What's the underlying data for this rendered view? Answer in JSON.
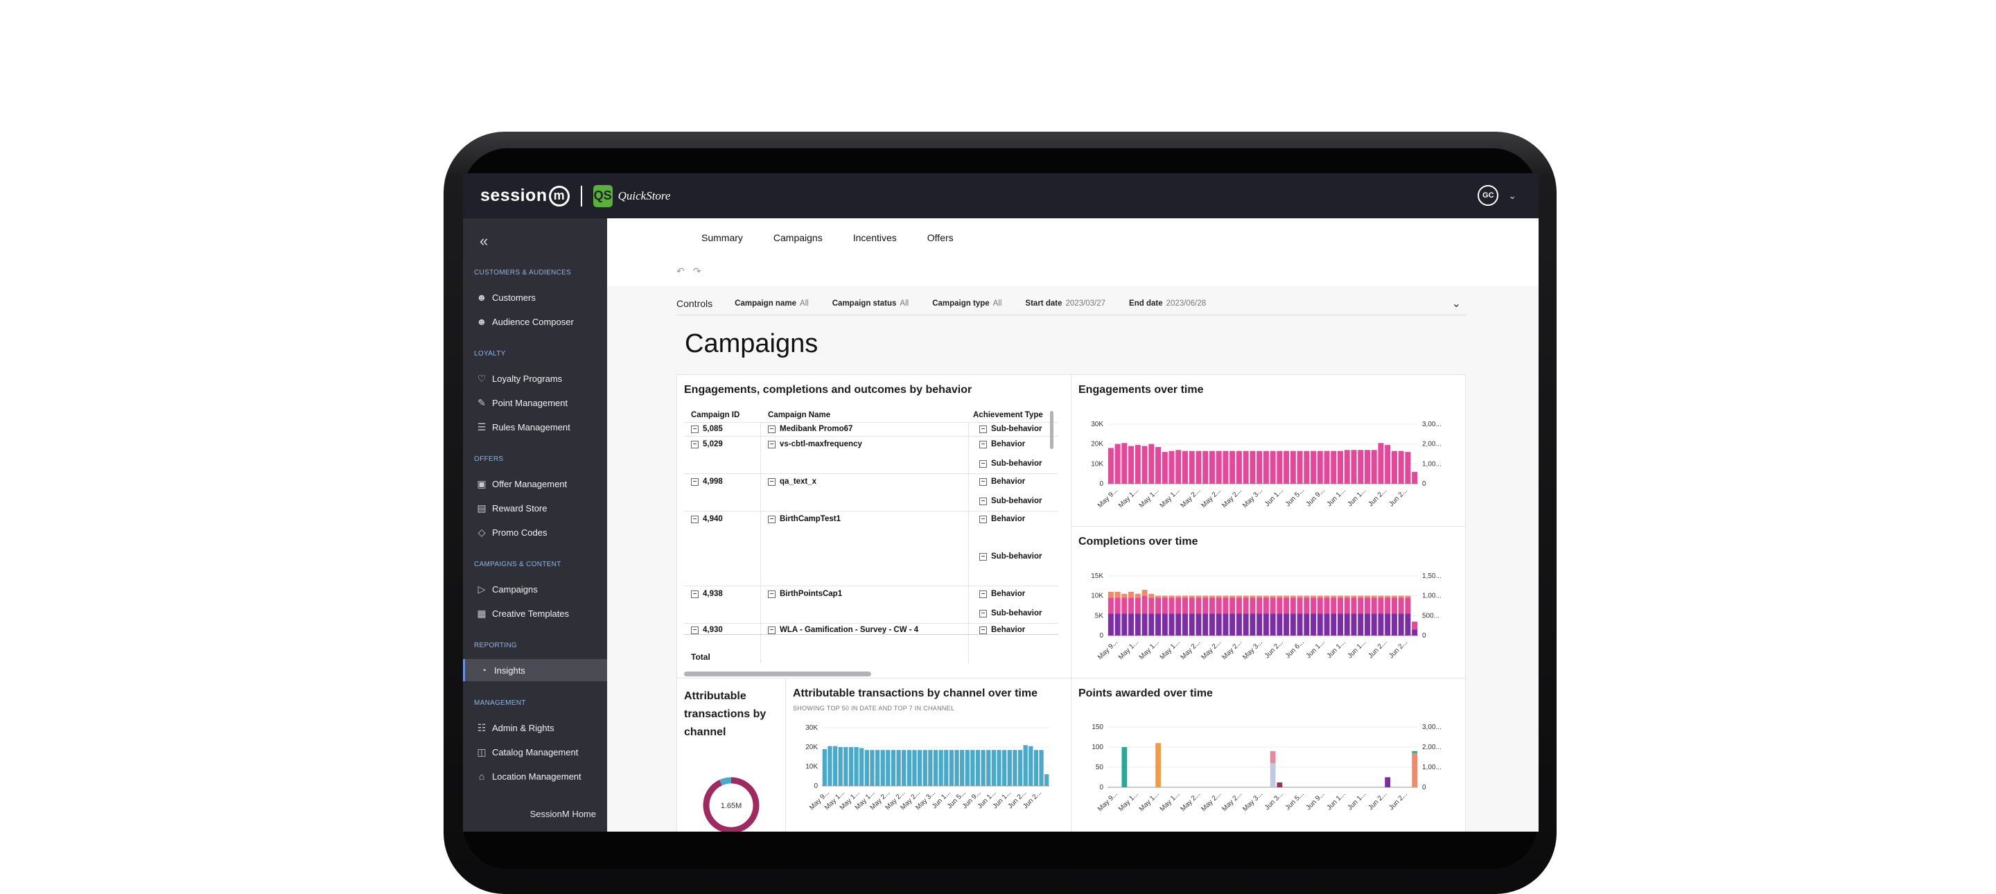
{
  "brand": {
    "name": "session",
    "mark": "m",
    "store_name": "QuickStore",
    "store_logo": "QS"
  },
  "user": {
    "initials": "GC"
  },
  "sidebar": {
    "collapse_icon": "«",
    "sections": [
      {
        "label": "CUSTOMERS & AUDIENCES",
        "items": [
          {
            "label": "Customers",
            "icon": "person-icon"
          },
          {
            "label": "Audience Composer",
            "icon": "person-icon"
          }
        ]
      },
      {
        "label": "LOYALTY",
        "items": [
          {
            "label": "Loyalty Programs",
            "icon": "heart-icon"
          },
          {
            "label": "Point Management",
            "icon": "edit-icon"
          },
          {
            "label": "Rules Management",
            "icon": "list-icon"
          }
        ]
      },
      {
        "label": "OFFERS",
        "items": [
          {
            "label": "Offer Management",
            "icon": "gift-icon"
          },
          {
            "label": "Reward Store",
            "icon": "store-icon"
          },
          {
            "label": "Promo Codes",
            "icon": "tag-icon"
          }
        ]
      },
      {
        "label": "CAMPAIGNS & CONTENT",
        "items": [
          {
            "label": "Campaigns",
            "icon": "megaphone-icon"
          },
          {
            "label": "Creative Templates",
            "icon": "template-icon"
          }
        ]
      },
      {
        "label": "REPORTING",
        "items": [
          {
            "label": "Insights",
            "icon": "insights-icon",
            "active": true
          }
        ]
      },
      {
        "label": "MANAGEMENT",
        "items": [
          {
            "label": "Admin & Rights",
            "icon": "admin-icon"
          },
          {
            "label": "Catalog Management",
            "icon": "book-icon"
          },
          {
            "label": "Location Management",
            "icon": "home-icon"
          }
        ]
      }
    ],
    "footer_link": "SessionM Home"
  },
  "tabs": [
    "Summary",
    "Campaigns",
    "Incentives",
    "Offers"
  ],
  "controls": {
    "title": "Controls",
    "filters": [
      {
        "label": "Campaign name",
        "value": "All"
      },
      {
        "label": "Campaign status",
        "value": "All"
      },
      {
        "label": "Campaign type",
        "value": "All"
      },
      {
        "label": "Start date",
        "value": "2023/03/27"
      },
      {
        "label": "End date",
        "value": "2023/06/28"
      }
    ]
  },
  "page_title": "Campaigns",
  "table_panel": {
    "title": "Engagements, completions and outcomes by behavior",
    "headers": [
      "Campaign ID",
      "Campaign Name",
      "Achievement Type"
    ],
    "rows": [
      {
        "id": "5,085",
        "name": "Medibank Promo67",
        "types": [
          "Sub-behavior"
        ]
      },
      {
        "id": "5,029",
        "name": "vs-cbtl-maxfrequency",
        "types": [
          "Behavior",
          "Sub-behavior"
        ]
      },
      {
        "id": "4,998",
        "name": "qa_text_x",
        "types": [
          "Behavior",
          "Sub-behavior"
        ]
      },
      {
        "id": "4,940",
        "name": "BirthCampTest1",
        "types": [
          "Behavior",
          "Sub-behavior"
        ]
      },
      {
        "id": "4,938",
        "name": "BirthPointsCap1",
        "types": [
          "Behavior",
          "Sub-behavior"
        ]
      },
      {
        "id": "4,930",
        "name": "WLA - Gamification - Survey - CW - 4",
        "types": [
          "Behavior"
        ]
      }
    ],
    "total_label": "Total"
  },
  "donut_panel": {
    "title_lines": [
      "Attributable",
      "transactions by",
      "channel"
    ],
    "center_label": "1.65M"
  },
  "chart_data": [
    {
      "type": "bar",
      "title": "Engagements over time",
      "y_ticks": [
        "30K",
        "20K",
        "10K",
        "0"
      ],
      "y2_ticks": [
        "3,00...",
        "2,00...",
        "1,00...",
        "0"
      ],
      "x_tick_labels": [
        "May 9...",
        "May 1...",
        "May 1...",
        "May 1...",
        "May 2...",
        "May 2...",
        "May 2...",
        "May 3...",
        "Jun 1...",
        "Jun 5...",
        "Jun 9...",
        "Jun 1...",
        "Jun 1...",
        "Jun 2...",
        "Jun 2..."
      ],
      "ylim": [
        0,
        30000
      ],
      "series": [
        {
          "values": [
            18000,
            20000,
            20500,
            19000,
            19500,
            19000,
            20000,
            18500,
            16000,
            16500,
            17000,
            16500,
            16500,
            16500,
            16500,
            16500,
            16500,
            16500,
            16500,
            16500,
            16500,
            16500,
            16500,
            16500,
            16500,
            16500,
            16500,
            16500,
            16500,
            16500,
            16500,
            16500,
            16500,
            16500,
            16500,
            17000,
            17000,
            17000,
            17000,
            17000,
            20500,
            19500,
            16500,
            16500,
            16000,
            6000
          ]
        }
      ],
      "colors": [
        "#e4489b"
      ]
    },
    {
      "type": "bar",
      "title": "Completions over time",
      "y_ticks": [
        "15K",
        "10K",
        "5K",
        "0"
      ],
      "y2_ticks": [
        "1,50...",
        "1,00...",
        "500...",
        "0"
      ],
      "x_tick_labels": [
        "May 9...",
        "May 1...",
        "May 1...",
        "May 1...",
        "May 2...",
        "May 2...",
        "May 2...",
        "May 3...",
        "Jun 2...",
        "Jun 6...",
        "Jun 1...",
        "Jun 1...",
        "Jun 1...",
        "Jun 2...",
        "Jun 2..."
      ],
      "ylim": [
        0,
        15000
      ],
      "series": [
        {
          "values": [
            5500,
            5500,
            5500,
            5500,
            5500,
            5500,
            5500,
            5500,
            5500,
            5500,
            5500,
            5500,
            5500,
            5500,
            5500,
            5500,
            5500,
            5500,
            5500,
            5500,
            5500,
            5500,
            5500,
            5500,
            5500,
            5500,
            5500,
            5500,
            5500,
            5500,
            5500,
            5500,
            5500,
            5500,
            5500,
            5500,
            5500,
            5500,
            5500,
            5500,
            5500,
            5500,
            5500,
            5500,
            5500,
            1500
          ]
        },
        {
          "values": [
            4000,
            4000,
            4000,
            4000,
            4000,
            4500,
            4000,
            4000,
            4000,
            4000,
            4000,
            4000,
            4000,
            4000,
            4000,
            4000,
            4000,
            4000,
            4000,
            4000,
            4000,
            4000,
            4000,
            4000,
            4000,
            4000,
            4000,
            4000,
            4000,
            4000,
            4000,
            4000,
            4000,
            4000,
            4000,
            4000,
            4000,
            4000,
            4000,
            4000,
            4000,
            4000,
            4000,
            4000,
            4000,
            2000
          ]
        },
        {
          "values": [
            1500,
            1500,
            1000,
            1500,
            1000,
            1500,
            1000,
            500,
            500,
            500,
            500,
            500,
            500,
            500,
            500,
            500,
            500,
            500,
            500,
            500,
            500,
            500,
            500,
            500,
            500,
            500,
            500,
            500,
            500,
            500,
            500,
            500,
            500,
            500,
            500,
            500,
            500,
            500,
            500,
            500,
            500,
            500,
            500,
            500,
            500,
            0
          ]
        }
      ],
      "colors": [
        "#7b2ea4",
        "#e4489b",
        "#f08a6b"
      ]
    },
    {
      "type": "bar",
      "title": "Attributable transactions by channel over time",
      "subtitle": "SHOWING TOP 50 IN DATE AND TOP 7 IN CHANNEL",
      "y_ticks": [
        "30K",
        "20K",
        "10K",
        "0"
      ],
      "x_tick_labels": [
        "May 9...",
        "May 1...",
        "May 1...",
        "May 1...",
        "May 2...",
        "May 2...",
        "May 2...",
        "May 3...",
        "Jun 1...",
        "Jun 5...",
        "Jun 9...",
        "Jun 1...",
        "Jun 1...",
        "Jun 2...",
        "Jun 2..."
      ],
      "ylim": [
        0,
        30000
      ],
      "series": [
        {
          "values": [
            19000,
            20500,
            20500,
            20000,
            20000,
            20000,
            20000,
            19500,
            18500,
            18500,
            18500,
            18500,
            18500,
            18500,
            18500,
            18500,
            18500,
            18500,
            18500,
            18500,
            18500,
            18500,
            18500,
            18500,
            18500,
            18500,
            18500,
            18500,
            18500,
            18500,
            18500,
            18500,
            18500,
            18500,
            18500,
            18500,
            18500,
            18500,
            21000,
            20500,
            18500,
            18500,
            6000
          ]
        }
      ],
      "colors": [
        "#4aa9c9"
      ]
    },
    {
      "type": "bar",
      "title": "Points awarded over time",
      "y_ticks": [
        "150",
        "100",
        "50",
        "0"
      ],
      "y2_ticks": [
        "3,00...",
        "2,00...",
        "1,00...",
        "0"
      ],
      "x_tick_labels": [
        "May 9...",
        "May 1...",
        "May 1...",
        "May 1...",
        "May 2...",
        "May 2...",
        "May 2...",
        "May 3...",
        "Jun 3...",
        "Jun 5...",
        "Jun 9...",
        "Jun 1...",
        "Jun 1...",
        "Jun 2...",
        "Jun 2..."
      ],
      "ylim": [
        0,
        150
      ],
      "bars": [
        {
          "index": 2,
          "value": 100,
          "color": "#29a79a"
        },
        {
          "index": 7,
          "value": 110,
          "color": "#f29a48"
        },
        {
          "index": 24,
          "value": 60,
          "color": "#c0c9e0"
        },
        {
          "index": 24,
          "value": 30,
          "color": "#e58a9e"
        },
        {
          "index": 25,
          "value": 12,
          "color": "#a12d5f"
        },
        {
          "index": 41,
          "value": 25,
          "color": "#7b2ea4"
        },
        {
          "index": 45,
          "value": 85,
          "color": "#f08a6b"
        },
        {
          "index": 45,
          "value": 5,
          "color": "#29a79a"
        }
      ],
      "slots": 46
    },
    {
      "type": "pie",
      "title": "Attributable transactions by channel",
      "total": "1.65M",
      "slices": [
        {
          "fraction": 0.93,
          "color": "#9e2a5f"
        },
        {
          "fraction": 0.07,
          "color": "#4aa9c9"
        }
      ]
    }
  ]
}
